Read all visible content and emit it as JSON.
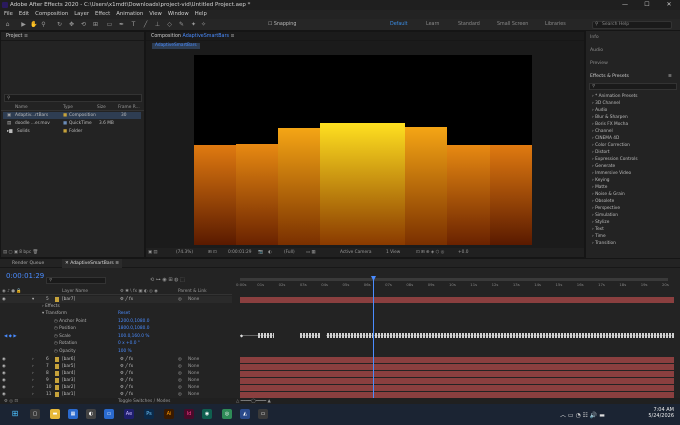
{
  "window": {
    "title": "Adobe After Effects 2020 - C:\\Users\\x1mdt\\Downloads\\project-vid\\Untitled Project.aep *",
    "min": "—",
    "max": "☐",
    "close": "✕"
  },
  "menu": [
    "File",
    "Edit",
    "Composition",
    "Layer",
    "Effect",
    "Animation",
    "View",
    "Window",
    "Help"
  ],
  "toolbar": {
    "snapping": "Snapping",
    "workspaces": [
      "Default",
      "Learn",
      "Standard",
      "Small Screen",
      "Libraries"
    ],
    "search": "Search Help"
  },
  "project": {
    "title": "Project",
    "columns": [
      "Name",
      "Type",
      "Size",
      "Frame R..."
    ],
    "rows": [
      {
        "name": "Adaptiv...rtBars",
        "type": "Composition",
        "size": "",
        "fr": "30"
      },
      {
        "name": "doodle ...er.mov",
        "type": "QuickTime",
        "size": "3.6 MB",
        "fr": ""
      },
      {
        "name": "Solids",
        "type": "Folder",
        "size": "",
        "fr": ""
      }
    ],
    "bpc": "8 bpc"
  },
  "composition": {
    "tab_prefix": "Composition",
    "tab_name": "AdaptiveSmartBars",
    "subtab": "AdaptiveSmartBars",
    "zoom": "(74.3%)",
    "time": "0:00:01:29",
    "quality": "(Full)",
    "camera": "Active Camera",
    "view": "1 View",
    "offset": "+0.0"
  },
  "right": {
    "items": [
      "Info",
      "Audio",
      "Preview"
    ],
    "effects_title": "Effects & Presets",
    "effects": [
      "* Animation Presets",
      "3D Channel",
      "Audio",
      "Blur & Sharpen",
      "Boris FX Mocha",
      "Channel",
      "CINEMA 4D",
      "Color Correction",
      "Distort",
      "Expression Controls",
      "Generate",
      "Immersive Video",
      "Keying",
      "Matte",
      "Noise & Grain",
      "Obsolete",
      "Perspective",
      "Simulation",
      "Stylize",
      "Text",
      "Time",
      "Transition"
    ]
  },
  "timeline": {
    "render_queue": "Render Queue",
    "comp_tab": "AdaptiveSmartBars",
    "time": "0:00:01:29",
    "col_layer": "Layer Name",
    "col_parent": "Parent & Link",
    "ruler": [
      "0:00s",
      "01s",
      "02s",
      "03s",
      "04s",
      "05s",
      "06s",
      "07s",
      "08s",
      "09s",
      "10s",
      "11s",
      "12s",
      "13s",
      "14s",
      "15s",
      "16s",
      "17s",
      "18s",
      "19s",
      "20s"
    ],
    "layers": [
      {
        "num": "5",
        "name": "[bar7]",
        "parent": "None"
      },
      {
        "num": "6",
        "name": "[bar6]",
        "parent": "None"
      },
      {
        "num": "7",
        "name": "[bar5]",
        "parent": "None"
      },
      {
        "num": "8",
        "name": "[bar4]",
        "parent": "None"
      },
      {
        "num": "9",
        "name": "[bar3]",
        "parent": "None"
      },
      {
        "num": "10",
        "name": "[bar2]",
        "parent": "None"
      },
      {
        "num": "11",
        "name": "[bar1]",
        "parent": "None"
      }
    ],
    "props": {
      "effects": "Effects",
      "transform": "Transform",
      "reset": "Reset",
      "anchor": "Anchor Point",
      "anchor_val": "1200.0,1080.0",
      "position": "Position",
      "position_val": "1800.0,1080.0",
      "scale": "Scale",
      "scale_val": "100.0,160.0 %",
      "rotation": "Rotation",
      "rotation_val": "0 x +0.0 °",
      "opacity": "Opacity",
      "opacity_val": "100 %"
    },
    "toggle": "Toggle Switches / Modes"
  },
  "taskbar": {
    "time": "7:04 AM",
    "date": "5/24/2026"
  }
}
